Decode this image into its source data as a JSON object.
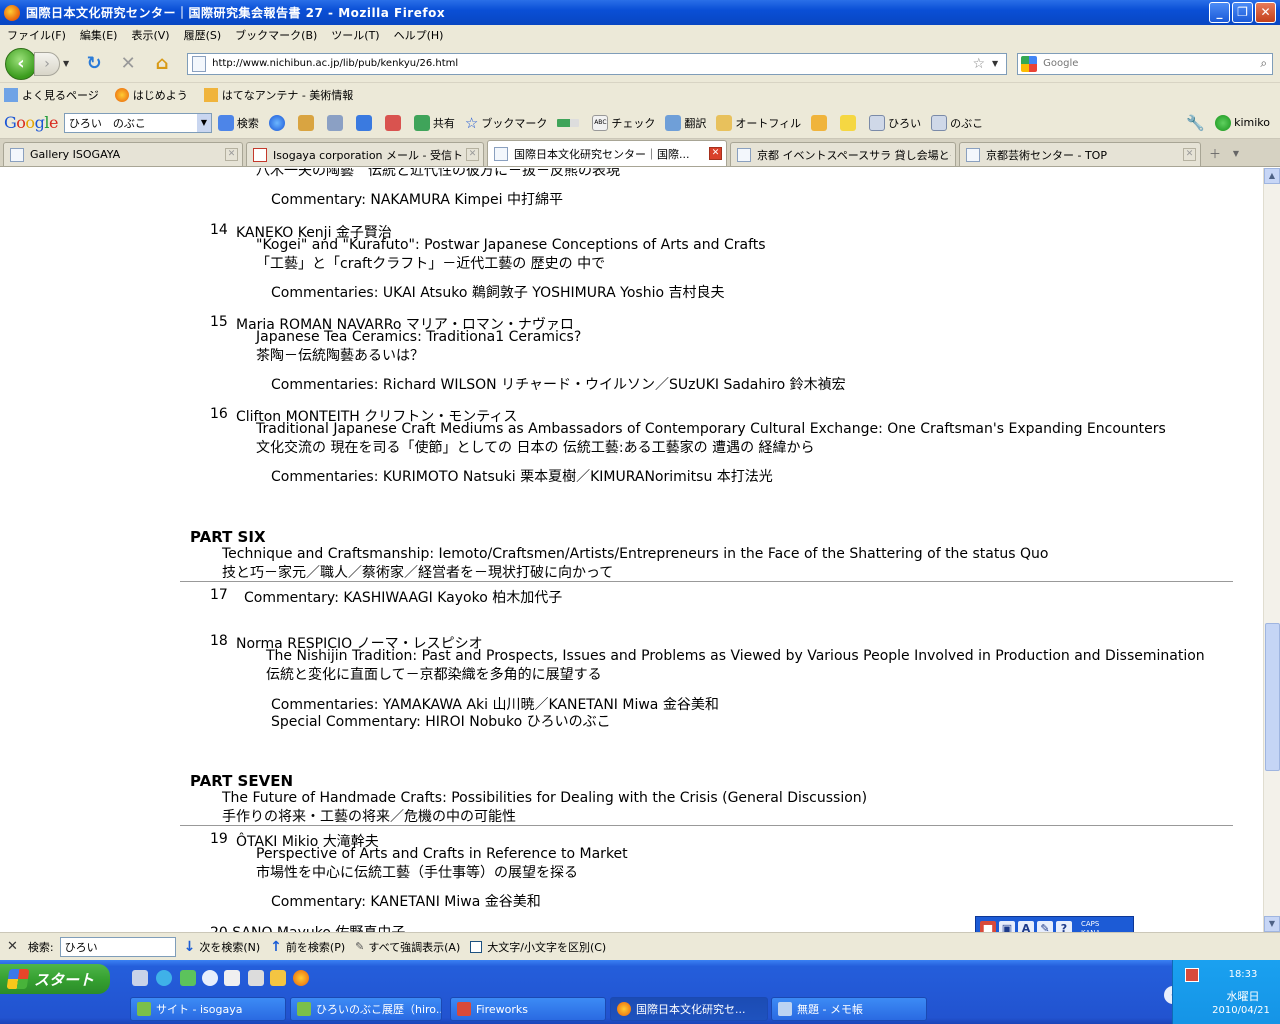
{
  "window": {
    "title": "国際日本文化研究センター｜国際研究集会報告書 27 - Mozilla Firefox"
  },
  "menu": [
    "ファイル(F)",
    "編集(E)",
    "表示(V)",
    "履歴(S)",
    "ブックマーク(B)",
    "ツール(T)",
    "ヘルプ(H)"
  ],
  "nav": {
    "url": "http://www.nichibun.ac.jp/lib/pub/kenkyu/26.html",
    "search_placeholder": "Google"
  },
  "bookmarks": [
    "よく見るページ",
    "はじめよう",
    "はてなアンテナ - 美術情報"
  ],
  "google_toolbar": {
    "logo": "Google",
    "query": "ひろい　のぶこ",
    "items": [
      "検索",
      "共有",
      "ブックマーク",
      "チェック",
      "翻訳",
      "オートフィル",
      "ひろい",
      "のぶこ",
      "kimiko"
    ]
  },
  "tabs": [
    "Gallery ISOGAYA",
    "Isogaya corporation メール - 受信トレ...",
    "国際日本文化研究センター｜国際...",
    "京都 イベントスペースサラ 貸し会場とイ...",
    "京都芸術センター - TOP"
  ],
  "content": {
    "top_partial": "八木一夫の陶藝　伝統と近代性の彼方に－抜－反熊の表現",
    "e13_comment": "Commentary: NAKAMURA  Kimpei   中打綿平",
    "e14": {
      "num": "14",
      "author": "KANEKO Kenji   金子賢治",
      "title_en": "\"Kogei\" and \"Kurafuto\": Postwar Japanese Conceptions of Arts and Crafts",
      "title_ja": "「工藝」と「craftクラフト」－近代工藝の 歴史の 中で",
      "comment": "Commentaries: UKAI Atsuko 鵜飼敦子   YOSHIMURA Yoshio 吉村良夫"
    },
    "e15": {
      "num": "15",
      "author": "Maria ROMAN NAVARRo   マリア・ロマン・ナヴァロ",
      "title_en": "Japanese Tea Ceramics: Traditiona1 Ceramics?",
      "title_ja": "茶陶－伝統陶藝あるいは？",
      "comment": "Commentaries: Richard WILSON  リチャード・ウイルソン／SUzUKI Sadahiro   鈴木禎宏"
    },
    "e16": {
      "num": "16",
      "author": "Clifton MONTEITH   クリフトン・モンティス",
      "title_en": "Traditional Japanese Craft Mediums as Ambassadors of Contemporary Cultural Exchange: One Craftsman's Expanding Encounters",
      "title_ja": "文化交流の 現在を司る「使節」としての 日本の 伝統工藝:ある工藝家の 遭遇の 経緯から",
      "comment": "Commentaries: KURIMOTO Natsuki   栗本夏樹／KIMURANorimitsu   本打法光"
    },
    "part6": {
      "heading": "PART SIX",
      "title_en": "Technique and Craftsmanship: Iemoto/Craftsmen/Artists/Entrepreneurs in the Face of the Shattering of the status Quo",
      "title_ja": "技と巧－家元／職人／蔡術家／経営者を－現状打破に向かって"
    },
    "e17": {
      "num": "17",
      "text": "Commentary: KASHIWAAGI Kayoko   柏木加代子"
    },
    "e18": {
      "num": "18",
      "author": "Norma RESPICIO   ノーマ・レスピシオ",
      "title_en": "The Nishijin Tradition: Past and Prospects, Issues and Problems as Viewed by Various People Involved in Production and Dissemination",
      "title_ja": "伝統と変化に直面して－京都染織を多角的に展望する",
      "comment": "Commentaries: YAMAKAWA Aki   山川暁／KANETANI Miwa 金谷美和",
      "special": "Special Commentary: HIROI Nobuko  ひろいのぶこ"
    },
    "part7": {
      "heading": "PART SEVEN",
      "title_en": "The Future of Handmade Crafts: Possibilities for Dealing with the Crisis (General Discussion)",
      "title_ja": "手作りの将来・工藝の将来／危機の中の可能性"
    },
    "e19": {
      "num": "19",
      "author": "ÔTAKI Mikio   大滝幹夫",
      "title_en": "Perspective of Arts and Crafts in Reference to Market",
      "title_ja": "市場性を中心に伝統工藝（手仕事等）の展望を探る",
      "comment": "Commentary: KANETANI Miwa 金谷美和"
    },
    "bottom_partial": "20   SANO Mayuko   佐野真由子"
  },
  "findbar": {
    "label": "検索:",
    "value": "ひろい",
    "next": "次を検索(N)",
    "prev": "前を検索(P)",
    "highlight": "すべて強調表示(A)",
    "matchcase": "大文字/小文字を区別(C)"
  },
  "langbar": {
    "caps": "CAPS",
    "kana": "KANA"
  },
  "taskbar": {
    "start": "スタート",
    "buttons": [
      "サイト - isogaya",
      "ひろいのぶこ展歴（hiro...",
      "Fireworks",
      "国際日本文化研究セ...",
      "無題 - メモ帳"
    ],
    "time": "18:33",
    "day": "水曜日",
    "date": "2010/04/21"
  }
}
